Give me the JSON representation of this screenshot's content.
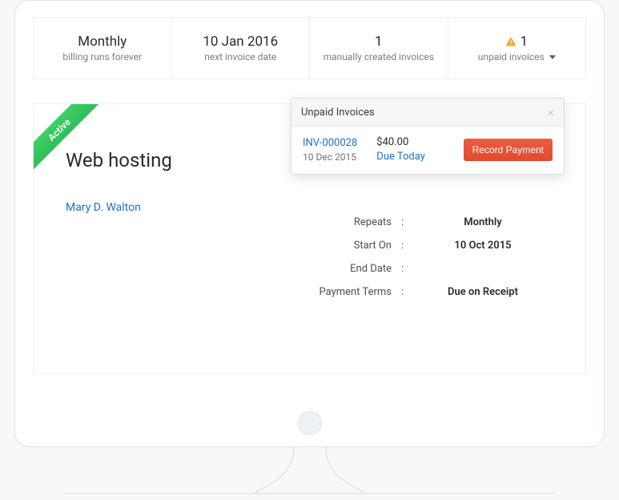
{
  "stats": {
    "frequency": {
      "top": "Monthly",
      "bottom": "billing runs forever"
    },
    "next_invoice": {
      "top": "10 Jan 2016",
      "bottom": "next invoice date"
    },
    "manual": {
      "top": "1",
      "bottom": "manually created invoices"
    },
    "unpaid": {
      "top": "1",
      "bottom": "unpaid invoices"
    }
  },
  "popover": {
    "title": "Unpaid Invoices",
    "invoice": {
      "number": "INV-000028",
      "date": "10 Dec 2015",
      "amount": "$40.00",
      "status": "Due Today"
    },
    "action": "Record Payment"
  },
  "card": {
    "ribbon": "Active",
    "title": "Web hosting",
    "customer": "Mary D. Walton",
    "details": {
      "repeats": {
        "label": "Repeats",
        "value": "Monthly"
      },
      "start_on": {
        "label": "Start On",
        "value": "10 Oct 2015"
      },
      "end_date": {
        "label": "End Date",
        "value": ""
      },
      "payment_terms": {
        "label": "Payment Terms",
        "value": "Due on Receipt"
      }
    }
  }
}
